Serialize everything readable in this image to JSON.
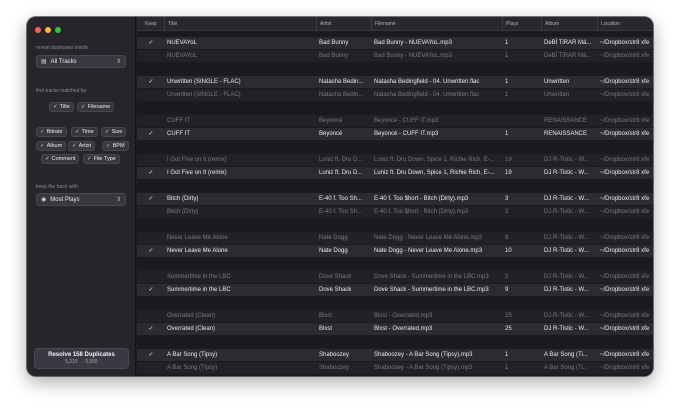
{
  "window": {
    "traffic_colors": [
      "#ff5f57",
      "#febc2e",
      "#28c840"
    ]
  },
  "sidebar": {
    "reveal_label": "reveal duplicates inside:",
    "source_select": {
      "icon": "library-icon",
      "value": "All Tracks"
    },
    "find_label": "find tracks matched by:",
    "match_chips": [
      "Title",
      "Filename"
    ],
    "field_chips": [
      [
        "Bitrate",
        "Time",
        "Size"
      ],
      [
        "Album",
        "Artist",
        "BPM"
      ],
      [
        "Comment",
        "File Type"
      ]
    ],
    "keep_label": "keep the track with:",
    "keep_select": {
      "icon": "play-circle-icon",
      "value": "Most Plays"
    },
    "resolve": {
      "title": "Resolve 158 Duplicates",
      "subtitle": "5,215 → 5,055"
    }
  },
  "table": {
    "columns": {
      "keep": "Keep",
      "title": "Title",
      "artist": "Artist",
      "filename": "Filename",
      "plays": "Plays",
      "album": "Album",
      "location": "Location"
    },
    "groups": [
      [
        {
          "keep": true,
          "title": "NUEVAYoL",
          "artist": "Bad Bunny",
          "filename": "Bad Bunny - NUEVAYoL.mp3",
          "plays": "1",
          "album": "DeBÍ TiRAR Má...",
          "location": "~/Dropbox/str8 xfe"
        },
        {
          "keep": false,
          "title": "NUEVAYoL",
          "artist": "Bad Bunny",
          "filename": "Bad Bunny - NUEVAYoL.mp3",
          "plays": "1",
          "album": "DeBÍ TiRAR Má...",
          "location": "~/Dropbox/str8 xfe"
        }
      ],
      [
        {
          "keep": true,
          "title": "Unwritten  (SINGLE - FLAC)",
          "artist": "Natasha Bedin...",
          "filename": "Natasha Bedingfield - 04. Unwritten.flac",
          "plays": "1",
          "album": "Unwritten",
          "location": "~/Dropbox/str8 xfe"
        },
        {
          "keep": false,
          "title": "Unwritten  (SINGLE - FLAC)",
          "artist": "Natasha Bedin...",
          "filename": "Natasha Bedingfield - 04. Unwritten.flac",
          "plays": "1",
          "album": "Unwritten",
          "location": "~/Dropbox/str8 xfe"
        }
      ],
      [
        {
          "keep": false,
          "title": "CUFF IT",
          "artist": "Beyoncé",
          "filename": "Beyoncé - CUFF IT.mp3",
          "plays": "",
          "album": "RENAISSANCE",
          "location": "~/Dropbox/str8 xfe"
        },
        {
          "keep": true,
          "title": "CUFF IT",
          "artist": "Beyoncé",
          "filename": "Beyoncé - CUFF IT.mp3",
          "plays": "1",
          "album": "RENAISSANCE",
          "location": "~/Dropbox/str8 xfe"
        }
      ],
      [
        {
          "keep": false,
          "title": "I Got Five on It (remix)",
          "artist": "Luniz ft. Dru D...",
          "filename": "Luniz ft. Dru Down, Spice 1, Richie Rich, E-...",
          "plays": "19",
          "album": "DJ R-Tistic - W...",
          "location": "~/Dropbox/str8 xfe"
        },
        {
          "keep": true,
          "title": "I Got Five on It (remix)",
          "artist": "Luniz ft. Dru D...",
          "filename": "Luniz ft. Dru Down, Spice 1, Richie Rich, E-...",
          "plays": "19",
          "album": "DJ R-Tistic - W...",
          "location": "~/Dropbox/str8 xfe"
        }
      ],
      [
        {
          "keep": true,
          "title": "Bitch (Dirty)",
          "artist": "E-40 f. Too Sh...",
          "filename": "E-40 f. Too $hort - Bitch (Dirty).mp3",
          "plays": "3",
          "album": "DJ R-Tistic - W...",
          "location": "~/Dropbox/str8 xfe"
        },
        {
          "keep": false,
          "title": "Bitch (Dirty)",
          "artist": "E-40 f. Too Sh...",
          "filename": "E-40 f. Too $hort - Bitch (Dirty).mp3",
          "plays": "3",
          "album": "DJ R-Tistic - W...",
          "location": "~/Dropbox/str8 xfe"
        }
      ],
      [
        {
          "keep": false,
          "title": "Never Leave Me Alone",
          "artist": "Nate Dogg",
          "filename": "Nate Dogg - Never Leave Me Alone.mp3",
          "plays": "8",
          "album": "DJ R-Tistic - W...",
          "location": "~/Dropbox/str8 xfe"
        },
        {
          "keep": true,
          "title": "Never Leave Me Alone",
          "artist": "Nate Dogg",
          "filename": "Nate Dogg - Never Leave Me Alone.mp3",
          "plays": "10",
          "album": "DJ R-Tistic - W...",
          "location": "~/Dropbox/str8 xfe"
        }
      ],
      [
        {
          "keep": false,
          "title": "Summertime in the LBC",
          "artist": "Dove Shack",
          "filename": "Dove Shack - Summertime in the LBC.mp3",
          "plays": "2",
          "album": "DJ R-Tistic - W...",
          "location": "~/Dropbox/str8 xfe"
        },
        {
          "keep": true,
          "title": "Summertime in the LBC",
          "artist": "Dove Shack",
          "filename": "Dove Shack - Summertime in the LBC.mp3",
          "plays": "9",
          "album": "DJ R-Tistic - W...",
          "location": "~/Dropbox/str8 xfe"
        }
      ],
      [
        {
          "keep": false,
          "title": "Overrated (Clean)",
          "artist": "Blxst",
          "filename": "Blxst - Overrated.mp3",
          "plays": "25",
          "album": "DJ R-Tistic - W...",
          "location": "~/Dropbox/str8 xfe"
        },
        {
          "keep": true,
          "title": "Overrated (Clean)",
          "artist": "Blxst",
          "filename": "Blxst - Overrated.mp3",
          "plays": "25",
          "album": "DJ R-Tistic - W...",
          "location": "~/Dropbox/str8 xfe"
        }
      ],
      [
        {
          "keep": true,
          "title": "A Bar Song (Tipsy)",
          "artist": "Shaboozey",
          "filename": "Shaboozey - A Bar Song (Tipsy).mp3",
          "plays": "1",
          "album": "A Bar Song (Ti...",
          "location": "~/Dropbox/str8 xfe"
        },
        {
          "keep": false,
          "title": "A Bar Song (Tipsy)",
          "artist": "Shaboozey",
          "filename": "Shaboozey - A Bar Song (Tipsy).mp3",
          "plays": "1",
          "album": "A Bar Song (Ti...",
          "location": "~/Dropbox/str8 xfe"
        }
      ]
    ]
  }
}
